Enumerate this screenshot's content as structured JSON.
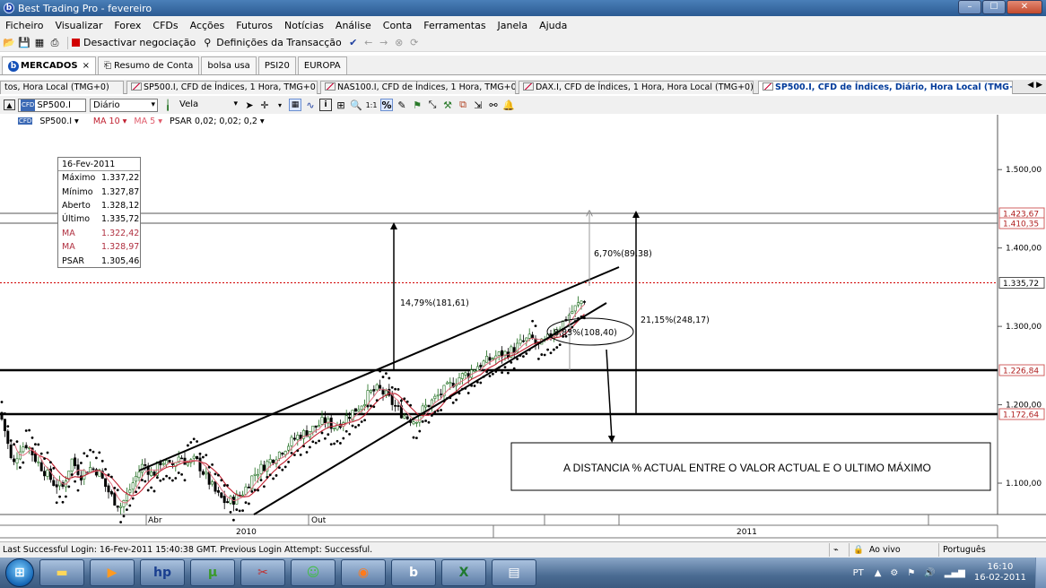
{
  "window": {
    "title": "Best Trading Pro - fevereiro",
    "app_logo": "b",
    "min": "–",
    "max": "☐",
    "close": "✕"
  },
  "menu": [
    "Ficheiro",
    "Visualizar",
    "Forex",
    "CFDs",
    "Acções",
    "Futuros",
    "Notícias",
    "Análise",
    "Conta",
    "Ferramentas",
    "Janela",
    "Ajuda"
  ],
  "toolbar": {
    "deactivate_label": "Desactivar negociação",
    "settings_label": "Definições da Transacção"
  },
  "workspace_tabs": [
    {
      "label": "MERCADOS",
      "close": "×"
    },
    {
      "label": "Resumo de Conta"
    },
    {
      "label": "bolsa usa"
    },
    {
      "label": "PSI20"
    },
    {
      "label": "EUROPA"
    }
  ],
  "chart_tabs": [
    "tos, Hora Local (TMG+0)",
    "SP500.I, CFD de Índices, 1 Hora, TMG+0",
    "NAS100.I, CFD de Índices, 1 Hora, TMG+0",
    "DAX.I, CFD de Índices, 1 Hora, Hora Local (TMG+0)",
    "SP500.I, CFD de Índices, Diário, Hora Local (TMG+0)"
  ],
  "chart_tab_close": "×",
  "chart_tab_scroll": "◀ ▶",
  "chart_toolbar": {
    "symbol": "SP500.I",
    "badge": "CFD",
    "timeframe": "Diário",
    "chart_style": "Vela"
  },
  "indicators": {
    "symbol": "SP500.I ▾",
    "ma10": "MA 10 ▾",
    "ma5": "MA 5 ▾",
    "psar": "PSAR 0,02; 0,02; 0,2 ▾"
  },
  "infobox": {
    "date": "16-Fev-2011",
    "rows": [
      {
        "k": "Máximo",
        "v": "1.337,22"
      },
      {
        "k": "Mínimo",
        "v": "1.327,87"
      },
      {
        "k": "Aberto",
        "v": "1.328,12"
      },
      {
        "k": "Último",
        "v": "1.335,72"
      },
      {
        "k": "MA",
        "v": "1.322,42"
      },
      {
        "k": "MA",
        "v": "1.328,97"
      },
      {
        "k": "PSAR",
        "v": "1.305,46"
      }
    ]
  },
  "colors": {
    "up": "#1a6b1a",
    "down": "#000000",
    "ma10": "#c02030",
    "ma5": "#e07080",
    "psar": "#000000",
    "current_line": "#d00000",
    "highlight_label": "#d06060"
  },
  "annotations": {
    "pct_top_right": "6,70%(89,38)",
    "pct_left": "14,79%(181,61)",
    "pct_right": "21,15%(248,17)",
    "pct_circle": "8,83%(108,40)",
    "note": "A DISTANCIA % ACTUAL ENTRE O VALOR ACTUAL E O ULTIMO MÁXIMO"
  },
  "chart_data": {
    "type": "candlestick",
    "symbol": "SP500.I",
    "timeframe": "Diário",
    "y_ticks": [
      "1.500,00",
      "1.400,00",
      "1.300,00",
      "1.200,00",
      "1.100,00"
    ],
    "y_tick_values": [
      1500,
      1400,
      1300,
      1200,
      1100
    ],
    "ylim": [
      1060,
      1570
    ],
    "price_labels": [
      {
        "value": 1423.67,
        "label": "1.423,67",
        "highlight": true
      },
      {
        "value": 1410.35,
        "label": "1.410,35",
        "highlight": true
      },
      {
        "value": 1335.72,
        "label": "1.335,72",
        "highlight": false
      },
      {
        "value": 1226.84,
        "label": "1.226,84",
        "highlight": true
      },
      {
        "value": 1172.64,
        "label": "1.172,64",
        "highlight": true
      }
    ],
    "x_month_labels": [
      "Abr",
      "Out"
    ],
    "x_year_labels": [
      "2010",
      "2011"
    ],
    "last_close": 1335.72,
    "path": [
      [
        0,
        1190
      ],
      [
        6,
        1165
      ],
      [
        14,
        1120
      ],
      [
        22,
        1145
      ],
      [
        30,
        1150
      ],
      [
        40,
        1130
      ],
      [
        50,
        1115
      ],
      [
        60,
        1100
      ],
      [
        70,
        1095
      ],
      [
        80,
        1130
      ],
      [
        90,
        1110
      ],
      [
        100,
        1120
      ],
      [
        110,
        1115
      ],
      [
        118,
        1095
      ],
      [
        126,
        1080
      ],
      [
        134,
        1070
      ],
      [
        142,
        1085
      ],
      [
        150,
        1105
      ],
      [
        160,
        1125
      ],
      [
        170,
        1110
      ],
      [
        180,
        1130
      ],
      [
        190,
        1120
      ],
      [
        200,
        1135
      ],
      [
        210,
        1125
      ],
      [
        218,
        1130
      ],
      [
        226,
        1115
      ],
      [
        234,
        1100
      ],
      [
        242,
        1085
      ],
      [
        252,
        1075
      ],
      [
        262,
        1080
      ],
      [
        272,
        1090
      ],
      [
        282,
        1110
      ],
      [
        292,
        1120
      ],
      [
        302,
        1130
      ],
      [
        312,
        1140
      ],
      [
        322,
        1150
      ],
      [
        332,
        1160
      ],
      [
        342,
        1165
      ],
      [
        352,
        1172
      ],
      [
        362,
        1180
      ],
      [
        372,
        1172
      ],
      [
        382,
        1180
      ],
      [
        392,
        1190
      ],
      [
        402,
        1200
      ],
      [
        412,
        1215
      ],
      [
        422,
        1220
      ],
      [
        432,
        1210
      ],
      [
        442,
        1195
      ],
      [
        452,
        1185
      ],
      [
        462,
        1180
      ],
      [
        472,
        1195
      ],
      [
        482,
        1205
      ],
      [
        492,
        1215
      ],
      [
        502,
        1225
      ],
      [
        512,
        1235
      ],
      [
        522,
        1240
      ],
      [
        532,
        1250
      ],
      [
        542,
        1255
      ],
      [
        552,
        1262
      ],
      [
        562,
        1265
      ],
      [
        572,
        1270
      ],
      [
        582,
        1280
      ],
      [
        592,
        1285
      ],
      [
        600,
        1275
      ],
      [
        608,
        1280
      ],
      [
        616,
        1292
      ],
      [
        624,
        1300
      ],
      [
        632,
        1312
      ],
      [
        640,
        1322
      ],
      [
        648,
        1332
      ],
      [
        652,
        1335
      ]
    ]
  },
  "status": {
    "message": "Last Successful Login: 16-Fev-2011 15:40:38 GMT. Previous Login Attempt: Successful.",
    "live": "Ao vivo",
    "language": "Português"
  },
  "taskbar": {
    "lang": "PT",
    "time": "16:10",
    "date": "16-02-2011"
  }
}
